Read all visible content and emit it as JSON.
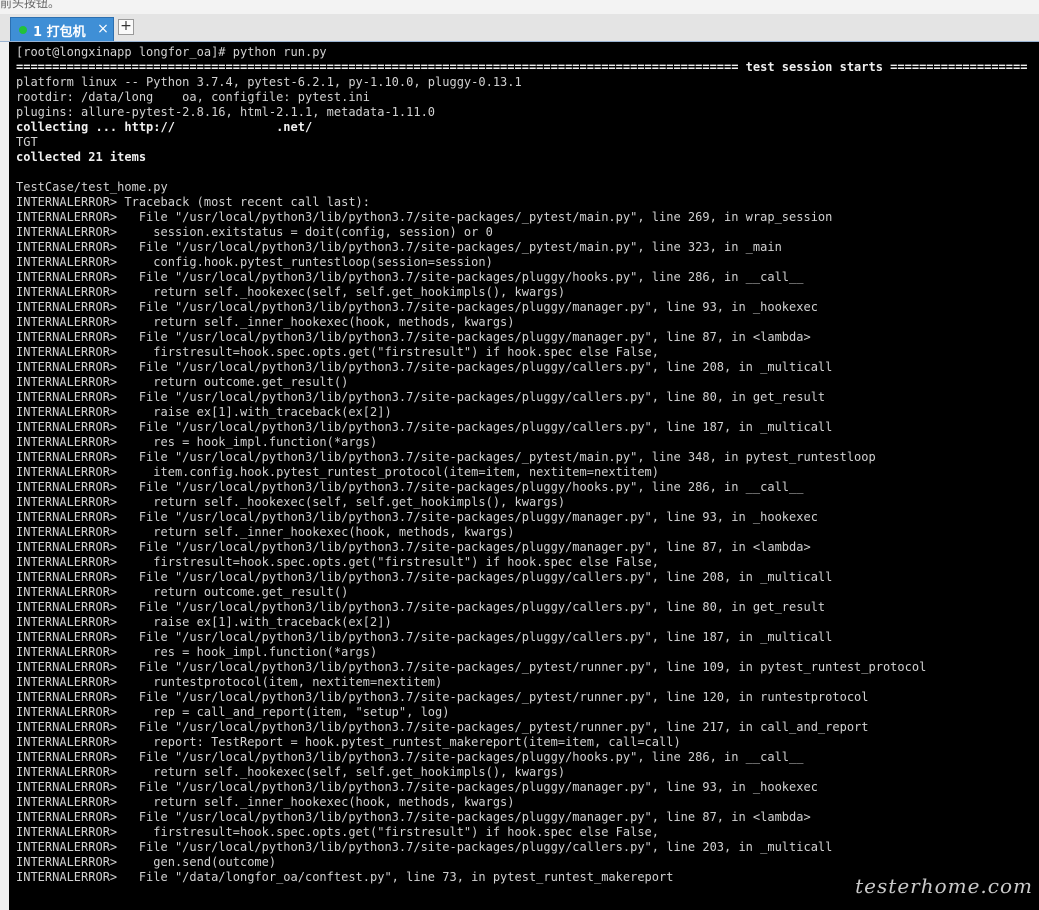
{
  "page_top": {
    "cut_text": "前头按钮。"
  },
  "tabbar": {
    "tab_label": "1 打包机",
    "close_glyph": "×",
    "add_glyph": "+"
  },
  "watermark": "testerhome.com",
  "terminal": {
    "lines": [
      {
        "text": "[root@longxinapp longfor_oa]# python run.py",
        "bold": false
      },
      {
        "text": "==================================================================================================== test session starts ===================",
        "bold": true
      },
      {
        "text": "platform linux -- Python 3.7.4, pytest-6.2.1, py-1.10.0, pluggy-0.13.1",
        "bold": false
      },
      {
        "text": "rootdir: /data/long    oa, configfile: pytest.ini",
        "bold": false
      },
      {
        "text": "plugins: allure-pytest-2.8.16, html-2.1.1, metadata-1.11.0",
        "bold": false
      },
      {
        "text": "collecting ... http://              .net/",
        "bold": true
      },
      {
        "text": "TGT",
        "bold": false
      },
      {
        "text": "collected 21 items",
        "bold": true
      },
      {
        "text": "",
        "bold": false
      },
      {
        "text": "TestCase/test_home.py",
        "bold": false
      },
      {
        "text": "INTERNALERROR> Traceback (most recent call last):",
        "bold": false
      },
      {
        "text": "INTERNALERROR>   File \"/usr/local/python3/lib/python3.7/site-packages/_pytest/main.py\", line 269, in wrap_session",
        "bold": false
      },
      {
        "text": "INTERNALERROR>     session.exitstatus = doit(config, session) or 0",
        "bold": false
      },
      {
        "text": "INTERNALERROR>   File \"/usr/local/python3/lib/python3.7/site-packages/_pytest/main.py\", line 323, in _main",
        "bold": false
      },
      {
        "text": "INTERNALERROR>     config.hook.pytest_runtestloop(session=session)",
        "bold": false
      },
      {
        "text": "INTERNALERROR>   File \"/usr/local/python3/lib/python3.7/site-packages/pluggy/hooks.py\", line 286, in __call__",
        "bold": false
      },
      {
        "text": "INTERNALERROR>     return self._hookexec(self, self.get_hookimpls(), kwargs)",
        "bold": false
      },
      {
        "text": "INTERNALERROR>   File \"/usr/local/python3/lib/python3.7/site-packages/pluggy/manager.py\", line 93, in _hookexec",
        "bold": false
      },
      {
        "text": "INTERNALERROR>     return self._inner_hookexec(hook, methods, kwargs)",
        "bold": false
      },
      {
        "text": "INTERNALERROR>   File \"/usr/local/python3/lib/python3.7/site-packages/pluggy/manager.py\", line 87, in <lambda>",
        "bold": false
      },
      {
        "text": "INTERNALERROR>     firstresult=hook.spec.opts.get(\"firstresult\") if hook.spec else False,",
        "bold": false
      },
      {
        "text": "INTERNALERROR>   File \"/usr/local/python3/lib/python3.7/site-packages/pluggy/callers.py\", line 208, in _multicall",
        "bold": false
      },
      {
        "text": "INTERNALERROR>     return outcome.get_result()",
        "bold": false
      },
      {
        "text": "INTERNALERROR>   File \"/usr/local/python3/lib/python3.7/site-packages/pluggy/callers.py\", line 80, in get_result",
        "bold": false
      },
      {
        "text": "INTERNALERROR>     raise ex[1].with_traceback(ex[2])",
        "bold": false
      },
      {
        "text": "INTERNALERROR>   File \"/usr/local/python3/lib/python3.7/site-packages/pluggy/callers.py\", line 187, in _multicall",
        "bold": false
      },
      {
        "text": "INTERNALERROR>     res = hook_impl.function(*args)",
        "bold": false
      },
      {
        "text": "INTERNALERROR>   File \"/usr/local/python3/lib/python3.7/site-packages/_pytest/main.py\", line 348, in pytest_runtestloop",
        "bold": false
      },
      {
        "text": "INTERNALERROR>     item.config.hook.pytest_runtest_protocol(item=item, nextitem=nextitem)",
        "bold": false
      },
      {
        "text": "INTERNALERROR>   File \"/usr/local/python3/lib/python3.7/site-packages/pluggy/hooks.py\", line 286, in __call__",
        "bold": false
      },
      {
        "text": "INTERNALERROR>     return self._hookexec(self, self.get_hookimpls(), kwargs)",
        "bold": false
      },
      {
        "text": "INTERNALERROR>   File \"/usr/local/python3/lib/python3.7/site-packages/pluggy/manager.py\", line 93, in _hookexec",
        "bold": false
      },
      {
        "text": "INTERNALERROR>     return self._inner_hookexec(hook, methods, kwargs)",
        "bold": false
      },
      {
        "text": "INTERNALERROR>   File \"/usr/local/python3/lib/python3.7/site-packages/pluggy/manager.py\", line 87, in <lambda>",
        "bold": false
      },
      {
        "text": "INTERNALERROR>     firstresult=hook.spec.opts.get(\"firstresult\") if hook.spec else False,",
        "bold": false
      },
      {
        "text": "INTERNALERROR>   File \"/usr/local/python3/lib/python3.7/site-packages/pluggy/callers.py\", line 208, in _multicall",
        "bold": false
      },
      {
        "text": "INTERNALERROR>     return outcome.get_result()",
        "bold": false
      },
      {
        "text": "INTERNALERROR>   File \"/usr/local/python3/lib/python3.7/site-packages/pluggy/callers.py\", line 80, in get_result",
        "bold": false
      },
      {
        "text": "INTERNALERROR>     raise ex[1].with_traceback(ex[2])",
        "bold": false
      },
      {
        "text": "INTERNALERROR>   File \"/usr/local/python3/lib/python3.7/site-packages/pluggy/callers.py\", line 187, in _multicall",
        "bold": false
      },
      {
        "text": "INTERNALERROR>     res = hook_impl.function(*args)",
        "bold": false
      },
      {
        "text": "INTERNALERROR>   File \"/usr/local/python3/lib/python3.7/site-packages/_pytest/runner.py\", line 109, in pytest_runtest_protocol",
        "bold": false
      },
      {
        "text": "INTERNALERROR>     runtestprotocol(item, nextitem=nextitem)",
        "bold": false
      },
      {
        "text": "INTERNALERROR>   File \"/usr/local/python3/lib/python3.7/site-packages/_pytest/runner.py\", line 120, in runtestprotocol",
        "bold": false
      },
      {
        "text": "INTERNALERROR>     rep = call_and_report(item, \"setup\", log)",
        "bold": false
      },
      {
        "text": "INTERNALERROR>   File \"/usr/local/python3/lib/python3.7/site-packages/_pytest/runner.py\", line 217, in call_and_report",
        "bold": false
      },
      {
        "text": "INTERNALERROR>     report: TestReport = hook.pytest_runtest_makereport(item=item, call=call)",
        "bold": false
      },
      {
        "text": "INTERNALERROR>   File \"/usr/local/python3/lib/python3.7/site-packages/pluggy/hooks.py\", line 286, in __call__",
        "bold": false
      },
      {
        "text": "INTERNALERROR>     return self._hookexec(self, self.get_hookimpls(), kwargs)",
        "bold": false
      },
      {
        "text": "INTERNALERROR>   File \"/usr/local/python3/lib/python3.7/site-packages/pluggy/manager.py\", line 93, in _hookexec",
        "bold": false
      },
      {
        "text": "INTERNALERROR>     return self._inner_hookexec(hook, methods, kwargs)",
        "bold": false
      },
      {
        "text": "INTERNALERROR>   File \"/usr/local/python3/lib/python3.7/site-packages/pluggy/manager.py\", line 87, in <lambda>",
        "bold": false
      },
      {
        "text": "INTERNALERROR>     firstresult=hook.spec.opts.get(\"firstresult\") if hook.spec else False,",
        "bold": false
      },
      {
        "text": "INTERNALERROR>   File \"/usr/local/python3/lib/python3.7/site-packages/pluggy/callers.py\", line 203, in _multicall",
        "bold": false
      },
      {
        "text": "INTERNALERROR>     gen.send(outcome)",
        "bold": false
      },
      {
        "text": "INTERNALERROR>   File \"/data/longfor_oa/conftest.py\", line 73, in pytest_runtest_makereport",
        "bold": false
      }
    ]
  },
  "colors": {
    "terminal_bg": "#000000",
    "terminal_fg": "#d2d2d2",
    "tab_active": "#3f8fd6",
    "status_dot": "#22c23a"
  }
}
